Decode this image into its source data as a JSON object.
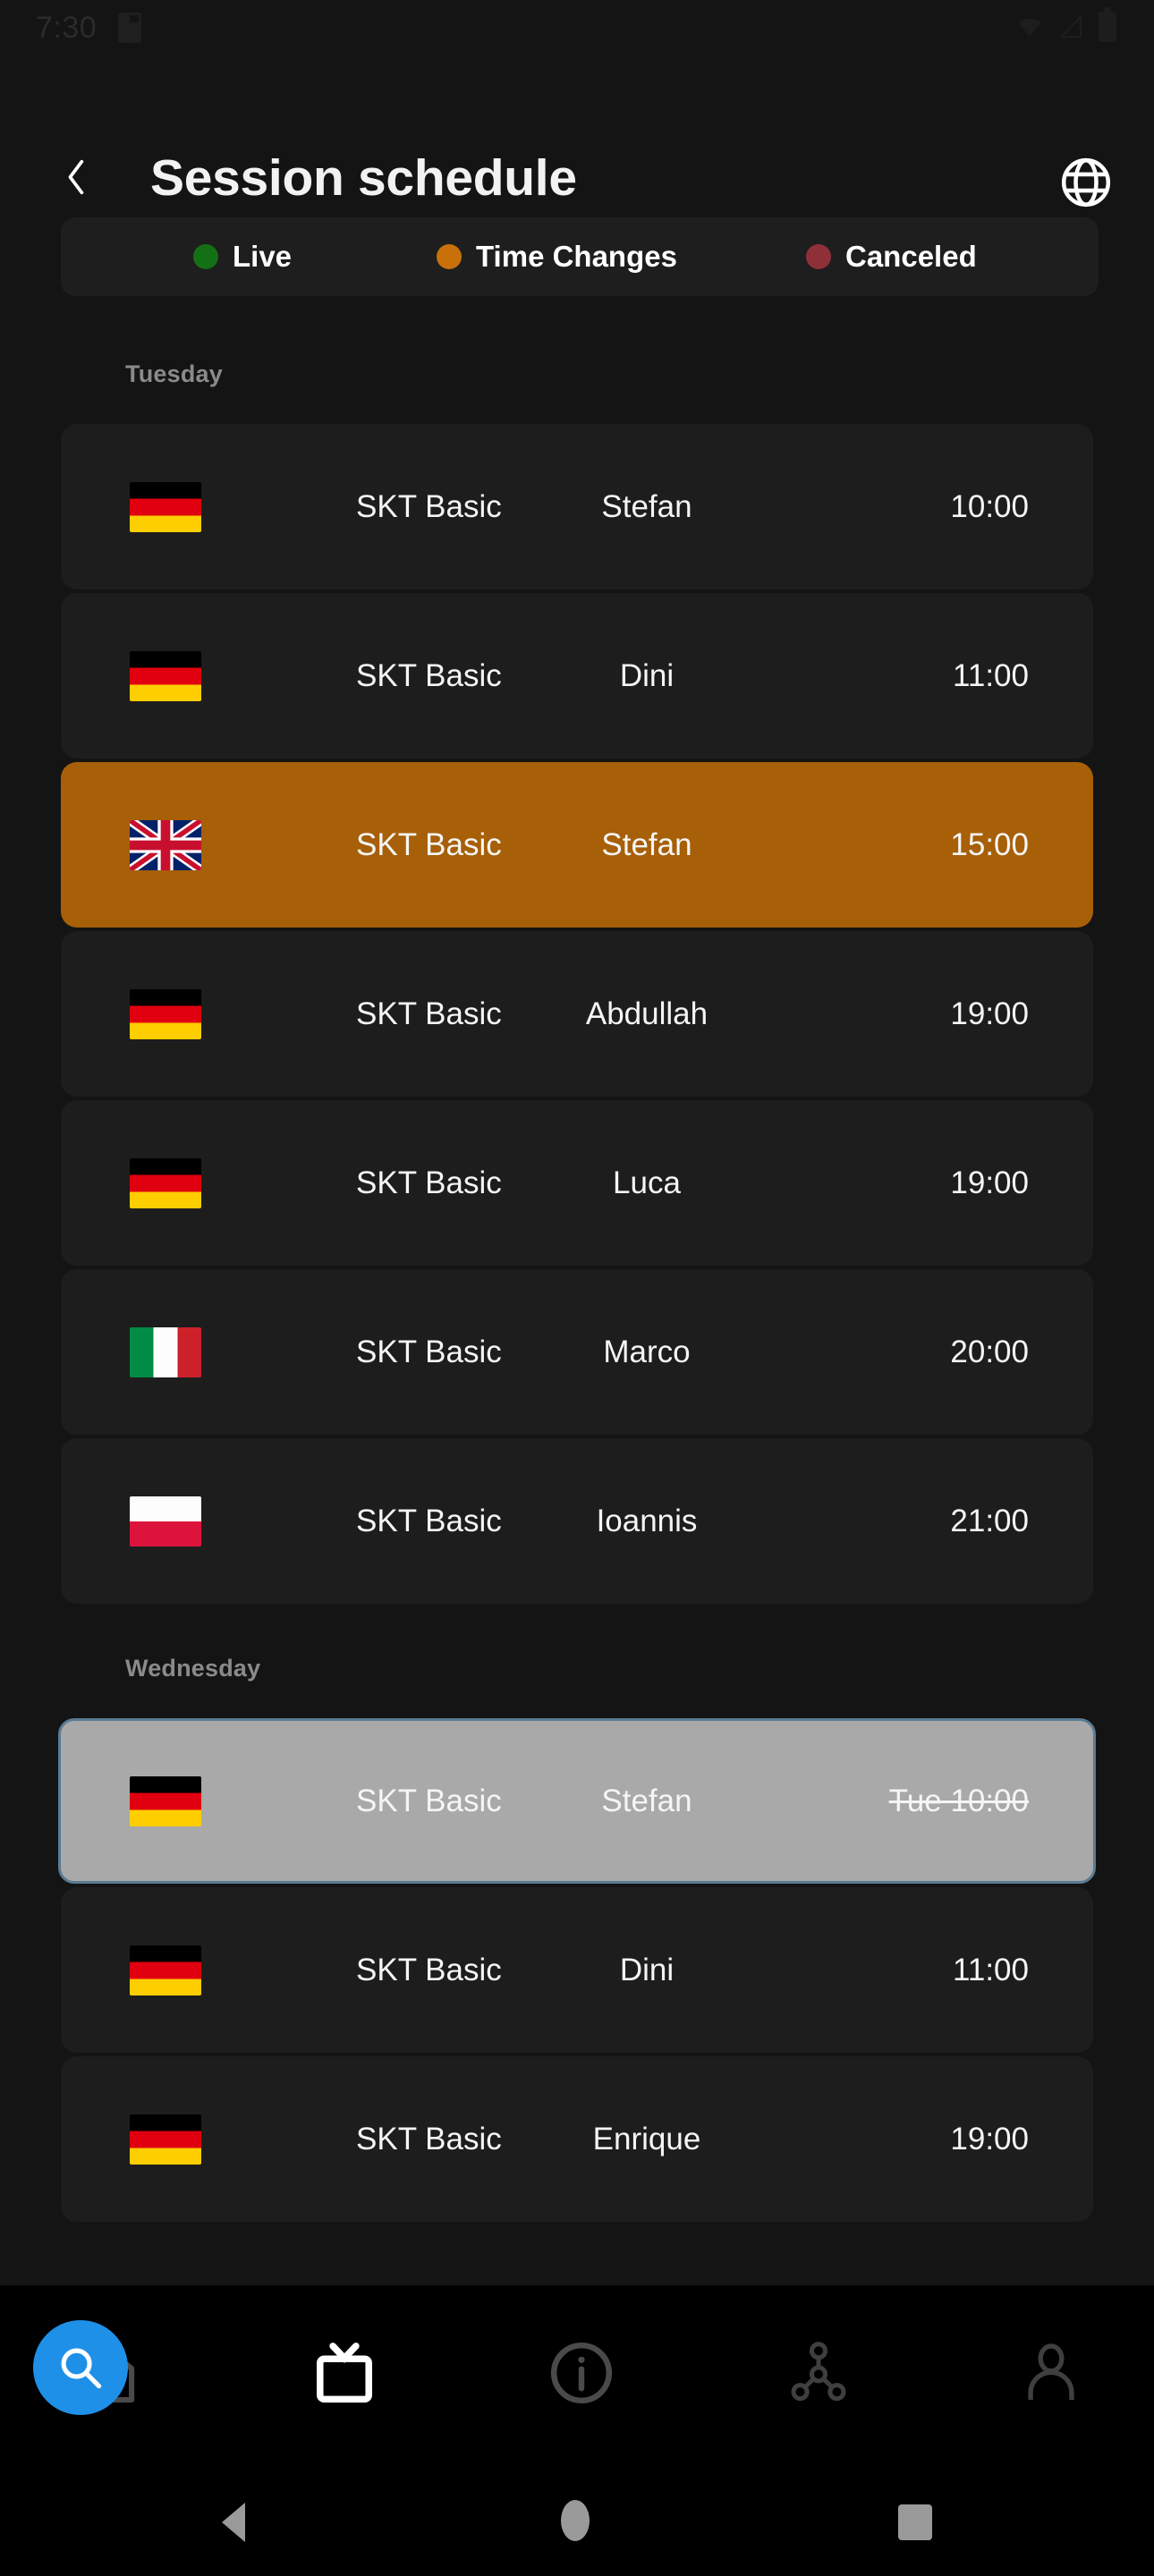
{
  "status_bar": {
    "time": "7:30",
    "icons": [
      "sd-card-icon",
      "wifi-icon",
      "signal-icon",
      "battery-icon"
    ]
  },
  "app_bar": {
    "back_icon": "chevron-left-icon",
    "title": "Session schedule",
    "action_icon": "globe-icon"
  },
  "legend": {
    "items": [
      {
        "label": "Live",
        "color": "#147014"
      },
      {
        "label": "Time Changes",
        "color": "#c9700a"
      },
      {
        "label": "Canceled",
        "color": "#8f3038"
      }
    ]
  },
  "colors": {
    "background": "#141414",
    "row": "#1d1d1d",
    "accent_row": "#a75f08",
    "selected_row": "#a9a9a9",
    "selected_border": "#5a7b93",
    "fab": "#1e90e8",
    "text": "#f5f5f5",
    "muted_text": "#8a8a8a"
  },
  "sections": [
    {
      "day": "Tuesday",
      "rows": [
        {
          "flag": "de",
          "flag_name": "flag-germany",
          "course": "SKT Basic",
          "coach": "Stefan",
          "time": "10:00",
          "state": "normal"
        },
        {
          "flag": "de",
          "flag_name": "flag-germany",
          "course": "SKT Basic",
          "coach": "Dini",
          "time": "11:00",
          "state": "normal"
        },
        {
          "flag": "gb",
          "flag_name": "flag-united-kingdom",
          "course": "SKT Basic",
          "coach": "Stefan",
          "time": "15:00",
          "state": "time-changed"
        },
        {
          "flag": "de",
          "flag_name": "flag-germany",
          "course": "SKT Basic",
          "coach": "Abdullah",
          "time": "19:00",
          "state": "normal"
        },
        {
          "flag": "de",
          "flag_name": "flag-germany",
          "course": "SKT Basic",
          "coach": "Luca",
          "time": "19:00",
          "state": "normal"
        },
        {
          "flag": "it",
          "flag_name": "flag-italy",
          "course": "SKT Basic",
          "coach": "Marco",
          "time": "20:00",
          "state": "normal"
        },
        {
          "flag": "pl",
          "flag_name": "flag-poland",
          "course": "SKT Basic",
          "coach": "Ioannis",
          "time": "21:00",
          "state": "normal"
        }
      ]
    },
    {
      "day": "Wednesday",
      "rows": [
        {
          "flag": "de",
          "flag_name": "flag-germany",
          "course": "SKT Basic",
          "coach": "Stefan",
          "time": "Tue 10:00",
          "state": "selected"
        },
        {
          "flag": "de",
          "flag_name": "flag-germany",
          "course": "SKT Basic",
          "coach": "Dini",
          "time": "11:00",
          "state": "normal"
        },
        {
          "flag": "de",
          "flag_name": "flag-germany",
          "course": "SKT Basic",
          "coach": "Enrique",
          "time": "19:00",
          "state": "normal"
        }
      ]
    }
  ],
  "bottom_nav": {
    "fab_icon": "search-icon",
    "items": [
      {
        "icon": "home-icon",
        "active": false
      },
      {
        "icon": "tv-icon",
        "active": true
      },
      {
        "icon": "info-icon",
        "active": false
      },
      {
        "icon": "share-icon",
        "active": false
      },
      {
        "icon": "person-icon",
        "active": false
      }
    ]
  },
  "android_nav": {
    "back": "back-triangle-icon",
    "home": "home-circle-icon",
    "recents": "recents-square-icon"
  }
}
